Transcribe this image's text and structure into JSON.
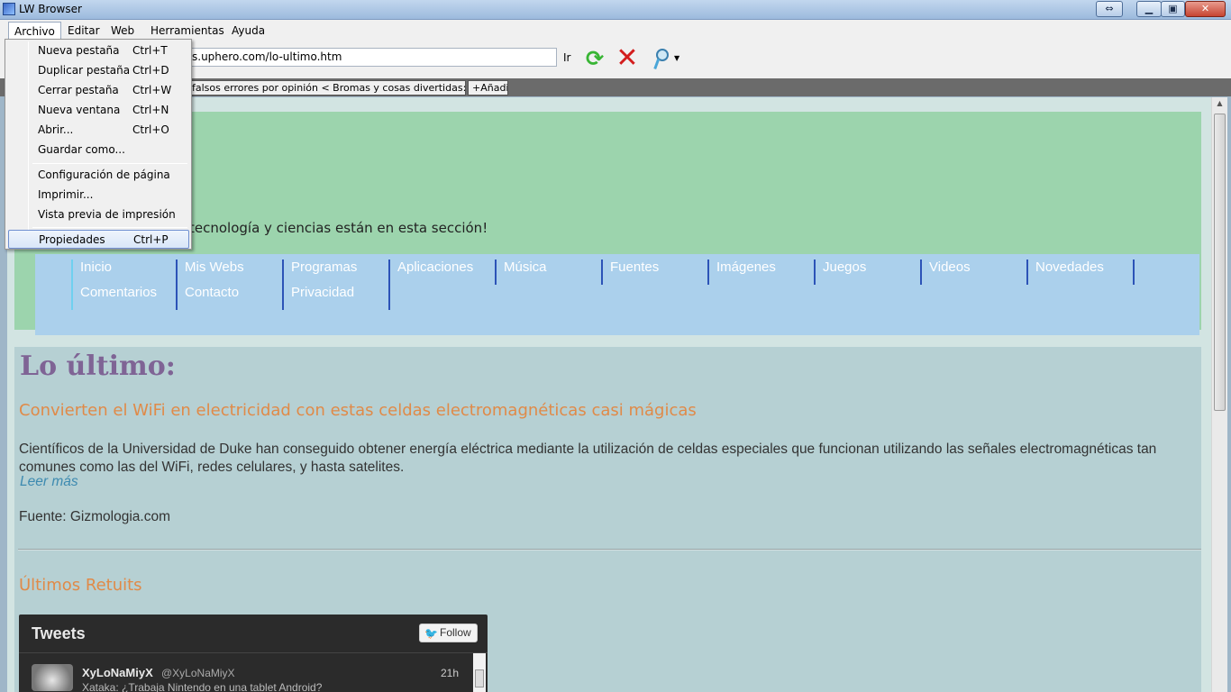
{
  "window": {
    "title": "LW Browser",
    "buttons": {
      "resize": "⇔",
      "minimize": "▁",
      "maximize": "▣",
      "close": "✕"
    }
  },
  "menubar": {
    "items": [
      "Archivo",
      "Editar",
      "Web",
      "Herramientas",
      "Ayuda"
    ],
    "active": "Archivo"
  },
  "toolbar": {
    "url": "s.uphero.com/lo-ultimo.htm",
    "go_label": "Ir",
    "icons": [
      "refresh-icon",
      "stop-icon",
      "search-icon"
    ]
  },
  "tabs": {
    "current": "falsos errores por opinión < Bromas y cosas divertidas: Softonic",
    "add": "+Añadir"
  },
  "archivo_menu": {
    "items": [
      {
        "label": "Nueva pestaña",
        "shortcut": "Ctrl+T"
      },
      {
        "label": "Duplicar pestaña",
        "shortcut": "Ctrl+D"
      },
      {
        "label": "Cerrar pestaña",
        "shortcut": "Ctrl+W"
      },
      {
        "label": "Nueva ventana",
        "shortcut": "Ctrl+N"
      },
      {
        "label": "Abrir...",
        "shortcut": "Ctrl+O"
      },
      {
        "label": "Guardar como...",
        "shortcut": ""
      },
      {
        "label": "Configuración de página",
        "shortcut": ""
      },
      {
        "label": "Imprimir...",
        "shortcut": ""
      },
      {
        "label": "Vista previa de impresión",
        "shortcut": ""
      },
      {
        "label": "Propiedades",
        "shortcut": "Ctrl+P"
      }
    ],
    "highlighted": "Propiedades"
  },
  "page": {
    "tagline": "tecnología y ciencias están en esta sección!",
    "nav": {
      "row1": [
        "Inicio",
        "Mis Webs",
        "Programas",
        "Aplicaciones",
        "Música",
        "Fuentes",
        "Imágenes",
        "Juegos",
        "Videos",
        "Novedades"
      ],
      "row2": [
        "Comentarios",
        "Contacto",
        "Privacidad"
      ]
    },
    "heading": "Lo último:",
    "article": {
      "title": "Convierten el WiFi en electricidad con estas celdas electromagnéticas casi mágicas",
      "body": "Científicos de la Universidad de Duke han conseguido obtener energía eléctrica mediante la utilización de celdas especiales que funcionan utilizando las señales electromagnéticas tan comunes como las del WiFi, redes celulares, y hasta satelites.",
      "read_more": "Leer más",
      "source": "Fuente: Gizmologia.com"
    },
    "retweets_title": "Últimos Retuits",
    "tweets_widget": {
      "header": "Tweets",
      "follow": "Follow",
      "tweet": {
        "user": "XyLoNaMiyX",
        "handle": "@XyLoNaMiyX",
        "time": "21h",
        "text": "Xataka: ¿Trabaja Nintendo en una tablet Android?"
      }
    }
  },
  "colors": {
    "header_band": "#9cd4ad",
    "nav_box": "#abd0ec",
    "nav_border": "#2c53b7",
    "heading": "#7f6495",
    "article_title": "#e08a48",
    "link": "#3d8ab0"
  }
}
